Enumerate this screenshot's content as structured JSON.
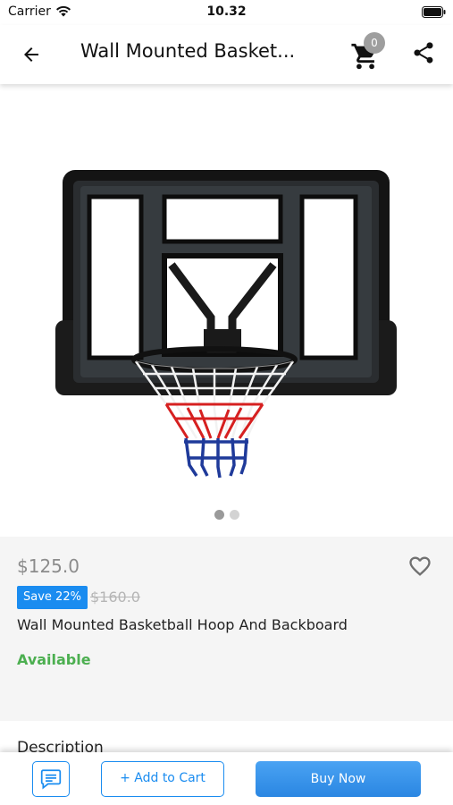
{
  "status_bar": {
    "carrier": "Carrier",
    "time": "10.32"
  },
  "app_bar": {
    "title": "Wall Mounted Basket...",
    "cart_count": "0"
  },
  "icons": {
    "back": "arrow-left-icon",
    "cart": "shopping-cart-icon",
    "share": "share-icon",
    "wishlist": "heart-outline-icon",
    "chat": "chat-bubble-icon",
    "wifi": "wifi-icon",
    "battery": "battery-icon"
  },
  "gallery": {
    "image": "basketball-hoop-backboard",
    "slides": 2,
    "active_slide": 1
  },
  "product": {
    "price": "$125.0",
    "save_badge": "Save 22%",
    "original_price": "$160.0",
    "name": "Wall Mounted Basketball Hoop And Backboard",
    "availability": "Available"
  },
  "description": {
    "title": "Description"
  },
  "bottom_bar": {
    "add_to_cart": "+ Add to Cart",
    "buy_now": "Buy Now"
  },
  "colors": {
    "accent": "#1a8cf0",
    "available": "#4caf50",
    "price": "#8c8c8c",
    "badge": "#9e9e9e"
  }
}
